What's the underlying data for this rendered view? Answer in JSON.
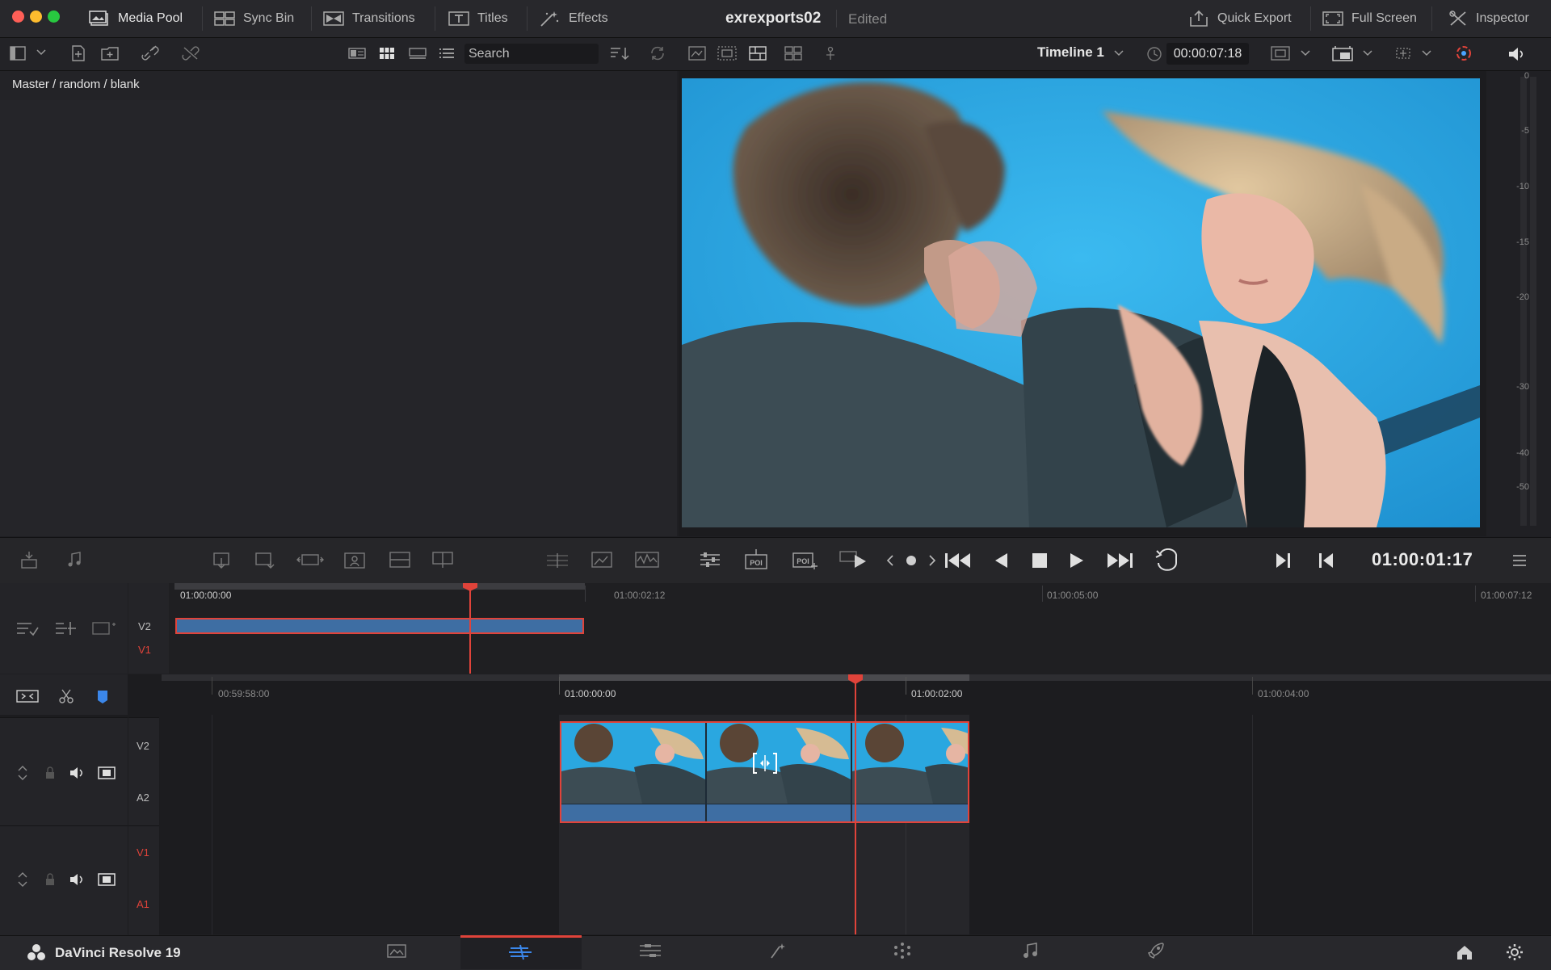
{
  "topbar": {
    "media_pool": "Media Pool",
    "sync_bin": "Sync Bin",
    "transitions": "Transitions",
    "titles": "Titles",
    "effects": "Effects",
    "project_name": "exrexports02",
    "project_status": "Edited",
    "quick_export": "Quick Export",
    "full_screen": "Full Screen",
    "inspector": "Inspector"
  },
  "toolbar": {
    "search_placeholder": "Search",
    "timeline_name": "Timeline 1",
    "timeline_duration": "00:00:07:18"
  },
  "media_pool": {
    "breadcrumb": "Master / random / blank"
  },
  "audio_meter": {
    "labels": [
      "0",
      "-5",
      "-10",
      "-15",
      "-20",
      "-30",
      "-40",
      "-50"
    ]
  },
  "transport": {
    "timecode": "01:00:01:17"
  },
  "upper_timeline": {
    "ruler": [
      "01:00:00:00",
      "01:00:02:12",
      "01:00:05:00",
      "01:00:07:12"
    ],
    "tracks": [
      "V2",
      "V1"
    ]
  },
  "lower_timeline": {
    "ruler": [
      "00:59:58:00",
      "01:00:00:00",
      "01:00:02:00",
      "01:00:04:00"
    ],
    "tracks": [
      {
        "video": "V2",
        "audio": "A2"
      },
      {
        "video": "V1",
        "audio": "A1"
      }
    ]
  },
  "bottombar": {
    "app_name": "DaVinci Resolve 19"
  },
  "colors": {
    "accent_red": "#e0433a",
    "clip_blue": "#3e6ea3",
    "sky": "#2aa7e0"
  }
}
